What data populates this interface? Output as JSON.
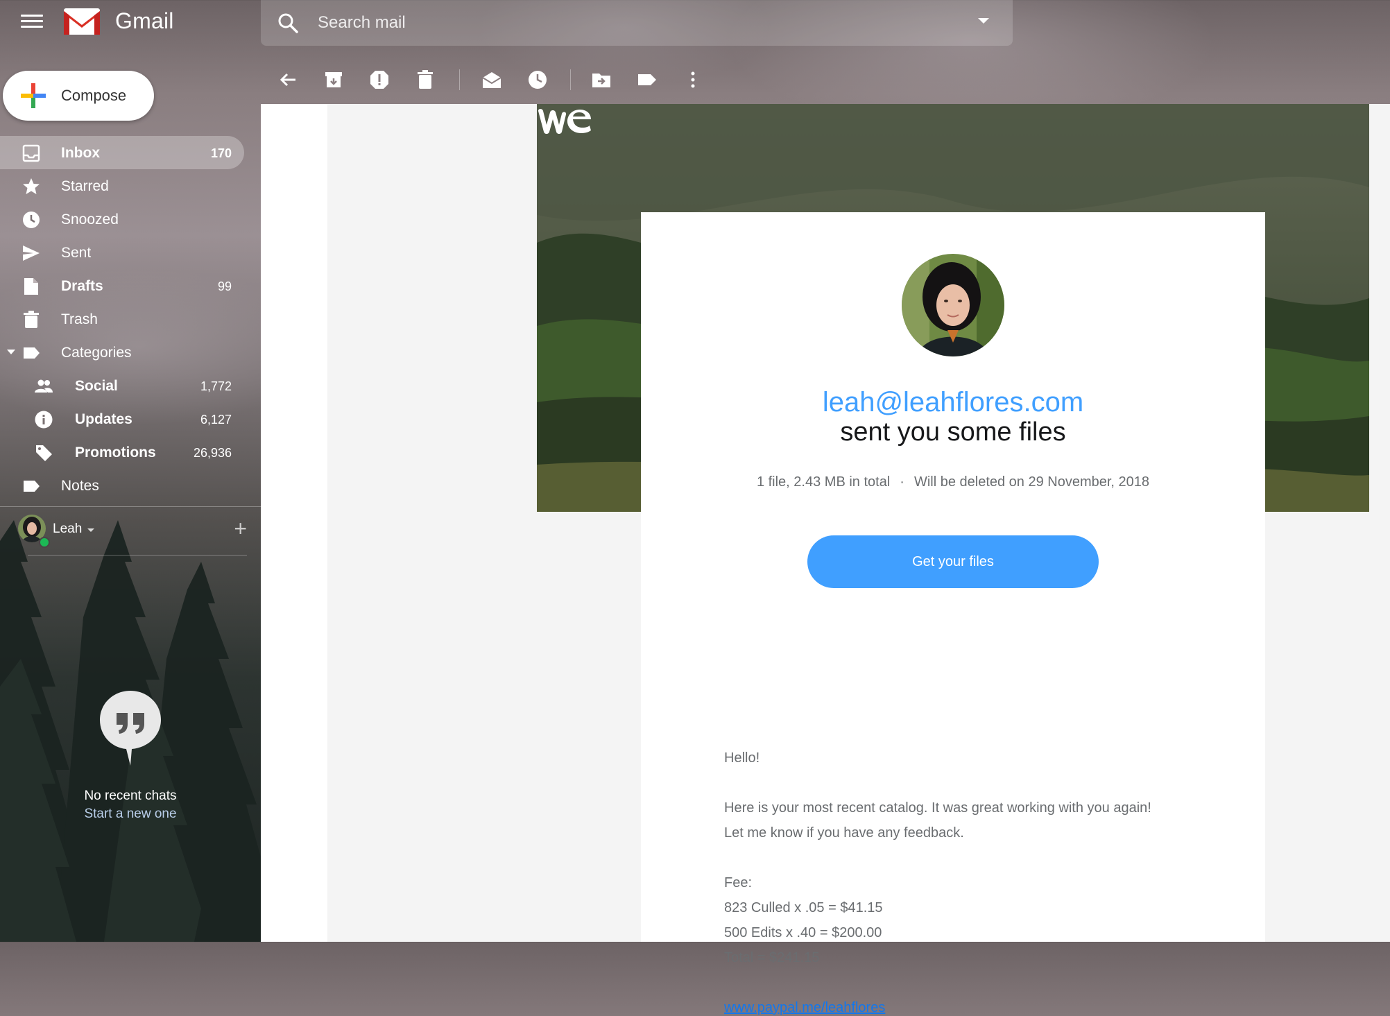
{
  "app": {
    "name": "Gmail"
  },
  "search": {
    "placeholder": "Search mail"
  },
  "compose": {
    "label": "Compose"
  },
  "sidebar": {
    "items": [
      {
        "label": "Inbox",
        "count": "170",
        "icon": "inbox-icon",
        "active": true
      },
      {
        "label": "Starred",
        "count": "",
        "icon": "star-icon"
      },
      {
        "label": "Snoozed",
        "count": "",
        "icon": "clock-icon"
      },
      {
        "label": "Sent",
        "count": "",
        "icon": "send-icon"
      },
      {
        "label": "Drafts",
        "count": "99",
        "icon": "draft-icon"
      },
      {
        "label": "Trash",
        "count": "",
        "icon": "trash-icon"
      },
      {
        "label": "Categories",
        "count": "",
        "icon": "label-icon"
      },
      {
        "label": "Social",
        "count": "1,772",
        "icon": "people-icon"
      },
      {
        "label": "Updates",
        "count": "6,127",
        "icon": "info-icon"
      },
      {
        "label": "Promotions",
        "count": "26,936",
        "icon": "tag-icon"
      },
      {
        "label": "Notes",
        "count": "",
        "icon": "label-icon"
      }
    ]
  },
  "hangouts": {
    "user_name": "Leah",
    "add_symbol": "+",
    "no_chats": "No recent chats",
    "start_new": "Start a new one"
  },
  "toolbar": {
    "icons": [
      "back-arrow-icon",
      "archive-icon",
      "report-spam-icon",
      "delete-icon",
      "mark-unread-icon",
      "snooze-icon",
      "move-to-icon",
      "label-icon",
      "more-vert-icon"
    ]
  },
  "email": {
    "sender_email": "leah@leahflores.com",
    "headline": "sent you some files",
    "file_info": "1 file, 2.43 MB in total",
    "separator": "·",
    "deletion_info": "Will be deleted on 29 November, 2018",
    "cta_label": "Get your files",
    "greeting": "Hello!",
    "message_line1": "Here is your most recent catalog. It was great working with you again!",
    "message_line2": "Let me know if you have any feedback.",
    "fee_label": "Fee:",
    "fee_line1": "823 Culled x .05 = $41.15",
    "fee_line2": "500 Edits x .40 = $200.00",
    "fee_total": "Total = $241.15",
    "link": "www.paypal.me/leahflores"
  },
  "colors": {
    "accent_blue": "#409fff",
    "online_green": "#1cb955",
    "gmail_red": "#d93025"
  }
}
